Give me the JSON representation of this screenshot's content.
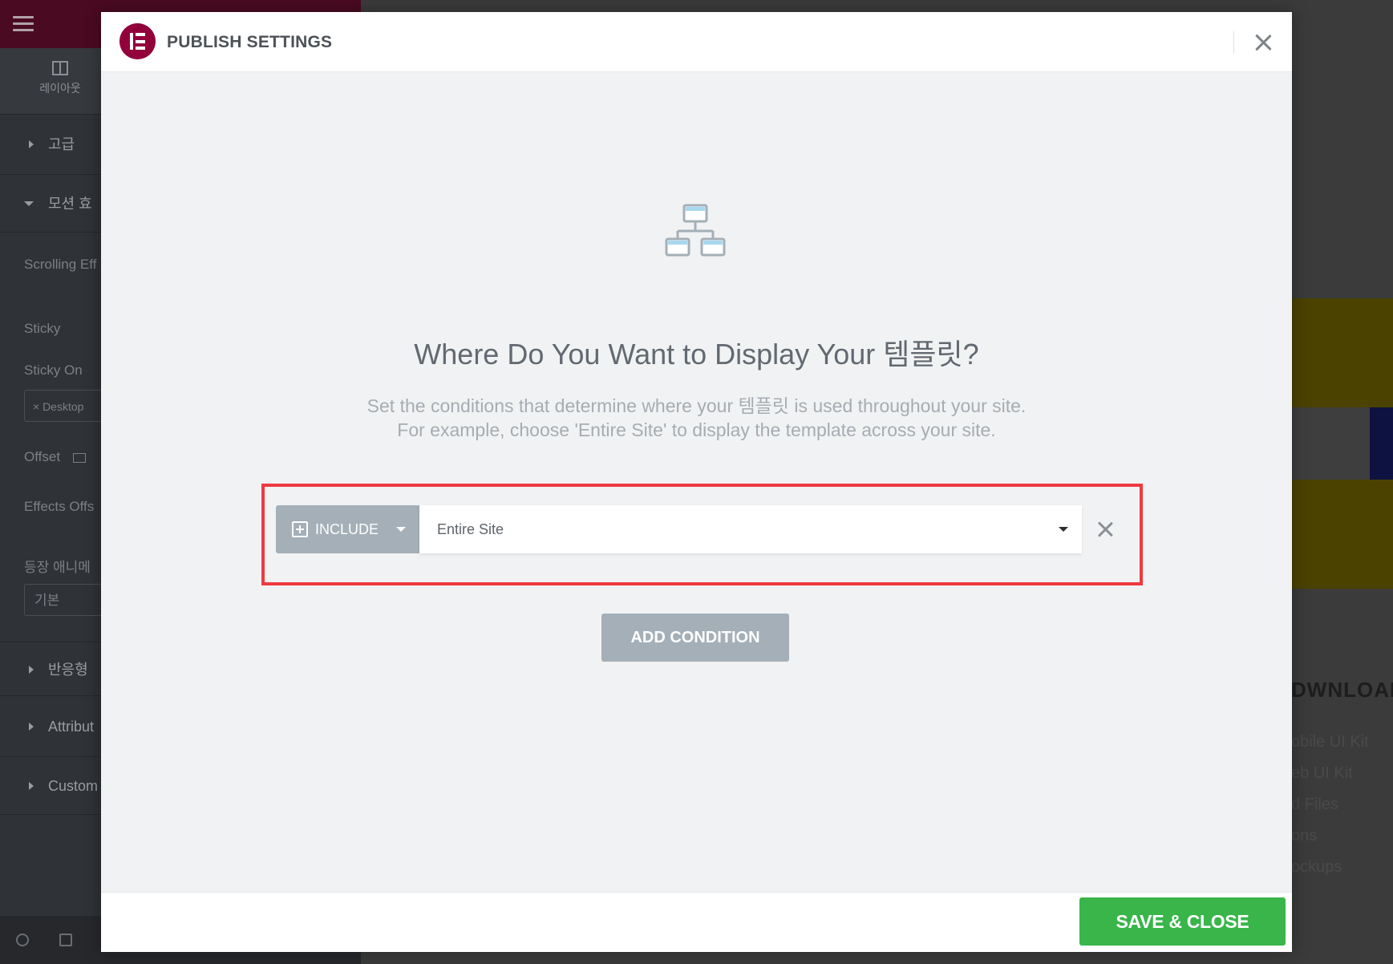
{
  "background_panel": {
    "layout_tab": "레이아웃",
    "sections": [
      {
        "label": "고급",
        "expanded": false
      },
      {
        "label": "모션 효",
        "expanded": true
      },
      {
        "label": "반응형",
        "expanded": false
      },
      {
        "label": "Attribut",
        "expanded": false
      },
      {
        "label": "Custom",
        "expanded": false
      }
    ],
    "fields": {
      "scrolling_effects": "Scrolling Eff",
      "sticky": "Sticky",
      "sticky_on": "Sticky On",
      "sticky_on_chip": "× Desktop",
      "offset": "Offset",
      "effects_offset": "Effects Offs",
      "entrance_animation": "등장 애니메",
      "entrance_value": "기본"
    }
  },
  "background_page": {
    "downloads_heading": "DWNLOAD",
    "download_items": [
      "obile UI Kit",
      "eb UI Kit",
      "d Files",
      "ons",
      "ockups"
    ]
  },
  "modal": {
    "title": "PUBLISH SETTINGS",
    "headline": "Where Do You Want to Display Your 템플릿?",
    "description_line1": "Set the conditions that determine where your 템플릿 is used throughout your site.",
    "description_line2": "For example, choose 'Entire Site' to display the template across your site.",
    "condition": {
      "type_label": "INCLUDE",
      "value": "Entire Site"
    },
    "add_condition_label": "ADD CONDITION",
    "save_close_label": "SAVE & CLOSE"
  },
  "colors": {
    "brand": "#92003b",
    "save": "#39b54a",
    "highlight": "#ef3a40",
    "include": "#a4afb7"
  },
  "icons": {
    "logo": "elementor-logo-icon",
    "hero": "sitemap-icon",
    "close": "close-icon",
    "remove": "remove-icon"
  }
}
